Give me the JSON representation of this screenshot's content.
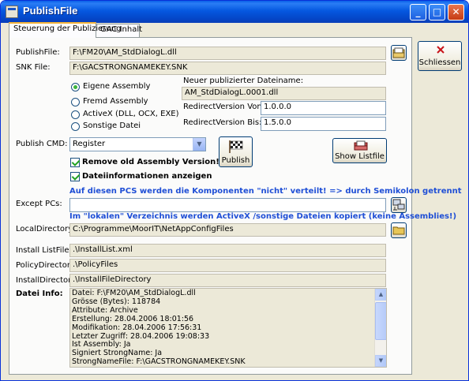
{
  "window": {
    "title": "PublishFile",
    "controls": {
      "minimize": "_",
      "maximize": "□",
      "close": "✕"
    }
  },
  "tabs": [
    {
      "label": "Steuerung der Publizierung",
      "active": true
    },
    {
      "label": "GAC Inhalt",
      "active": false
    }
  ],
  "fields": {
    "publishfile": {
      "label": "PublishFile:",
      "value": "F:\\FM20\\AM_StdDialogL.dll"
    },
    "snkfile": {
      "label": "SNK File:",
      "value": "F:\\GACSTRONGNAMEKEY.SNK"
    }
  },
  "radios": [
    {
      "label": "Eigene Assembly",
      "selected": true
    },
    {
      "label": "Fremd Assembly",
      "selected": false
    },
    {
      "label": "ActiveX (DLL, OCX, EXE)",
      "selected": false
    },
    {
      "label": "Sonstige Datei",
      "selected": false
    }
  ],
  "published": {
    "heading": "Neuer publizierter Dateiname:",
    "filename": "AM_StdDialogL.0001.dll",
    "von_label": "RedirectVersion Von:",
    "von_value": "1.0.0.0",
    "bis_label": "RedirectVersion Bis:",
    "bis_value": "1.5.0.0"
  },
  "publish_cmd": {
    "label": "Publish CMD:",
    "selected": "Register"
  },
  "checkboxes": [
    {
      "label": "Remove old Assembly Version!",
      "checked": true
    },
    {
      "label": "Dateiinformationen anzeigen",
      "checked": true
    }
  ],
  "buttons": {
    "publish": "Publish",
    "show_listfile": "Show Listfile",
    "close": "Schliessen"
  },
  "notes": {
    "pcs": "Auf diesen PCS werden die Komponenten \"nicht\" verteilt! => durch Semikolon getrennt",
    "local": "Im \"lokalen\" Verzeichnis werden ActiveX /sonstige Dateien kopiert (keine Assemblies!)"
  },
  "except_pcs": {
    "label": "Except PCs:",
    "value": ""
  },
  "local_directory": {
    "label": "LocalDirectory:",
    "value": "C:\\Programme\\MoorIT\\NetAppConfigFiles"
  },
  "install_listfile": {
    "label": "Install ListFile:",
    "value": ".\\InstallList.xml"
  },
  "policy_directory": {
    "label": "PolicyDirectory:",
    "value": ".\\PolicyFiles"
  },
  "install_directory": {
    "label": "InstallDirectory:",
    "value": ".\\InstallFileDirectory"
  },
  "datei_info": {
    "label": "Datei Info:",
    "lines": [
      "Datei: F:\\FM20\\AM_StdDialogL.dll",
      "Grösse (Bytes): 118784",
      "Attribute: Archive",
      "Erstellung: 28.04.2006 18:01:56",
      "Modifikation: 28.04.2006 17:56:31",
      "Letzter Zugriff: 28.04.2006 19:08:33",
      "Ist Assembly: Ja",
      "Signiert StrongName: Ja",
      "StrongNameFile:  F:\\GACSTRONGNAMEKEY.SNK"
    ]
  },
  "colors": {
    "titlebar": "#0558e0",
    "note_text": "#1f4fd6",
    "panel": "#fbfbfa",
    "window": "#ece9d8"
  },
  "icons": {
    "snk_button": "open-folder-icon",
    "publish": "checkered-flag-icon",
    "show_listfile": "open-folder-icon",
    "close": "red-x-icon",
    "except_pcs": "computer-network-icon",
    "local_directory": "folder-icon"
  }
}
